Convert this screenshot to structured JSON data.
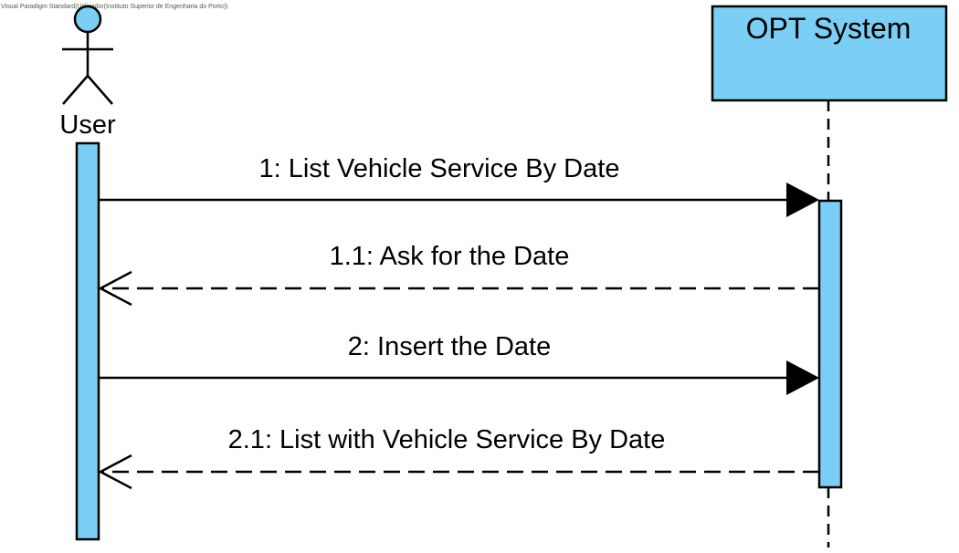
{
  "watermark": "Visual Paradigm Standard(Utilizador(Instituto Superior de Engenharia do Porto))",
  "actor": {
    "name": "User",
    "icon": "stick-figure-actor-icon"
  },
  "system": {
    "name": "OPT System"
  },
  "colors": {
    "fill": "#7ccff4",
    "stroke": "#000000",
    "background": "#ffffff"
  },
  "messages": [
    {
      "label": "1: List Vehicle Service By Date",
      "kind": "synchronous",
      "direction": "user-to-system"
    },
    {
      "label": "1.1: Ask for the Date",
      "kind": "return",
      "direction": "system-to-user"
    },
    {
      "label": "2: Insert the Date",
      "kind": "synchronous",
      "direction": "user-to-system"
    },
    {
      "label": "2.1: List with Vehicle Service By Date",
      "kind": "return",
      "direction": "system-to-user"
    }
  ]
}
